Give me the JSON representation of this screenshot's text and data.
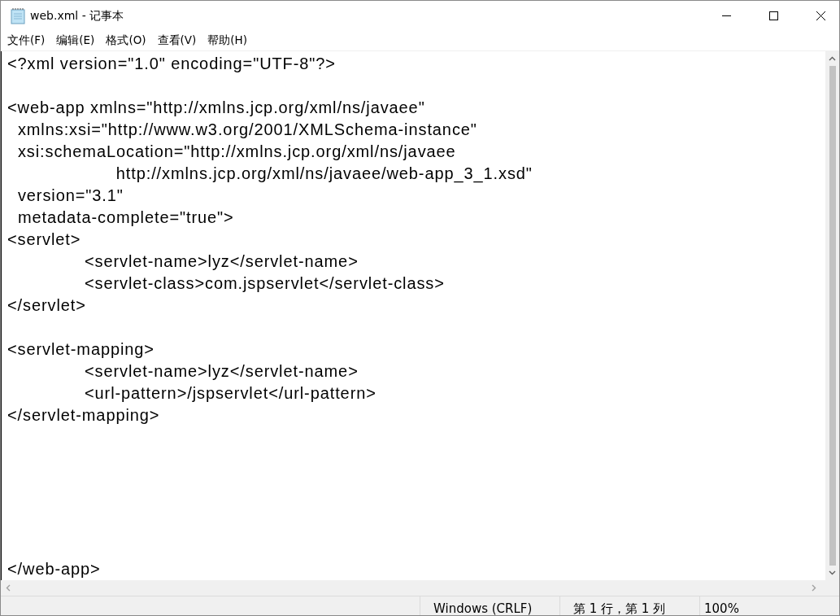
{
  "window": {
    "title": "web.xml - 记事本"
  },
  "menu": [
    "文件(F)",
    "编辑(E)",
    "格式(O)",
    "查看(V)",
    "帮助(H)"
  ],
  "editor": {
    "text": "<?xml version=\"1.0\" encoding=\"UTF-8\"?>\n\n<web-app xmlns=\"http://xmlns.jcp.org/xml/ns/javaee\"\n  xmlns:xsi=\"http://www.w3.org/2001/XMLSchema-instance\"\n  xsi:schemaLocation=\"http://xmlns.jcp.org/xml/ns/javaee\n\t      http://xmlns.jcp.org/xml/ns/javaee/web-app_3_1.xsd\"\n  version=\"3.1\"\n  metadata-complete=\"true\">\n<servlet>\n\t<servlet-name>lyz</servlet-name>\n\t<servlet-class>com.jspservlet</servlet-class>\n</servlet>\n\n<servlet-mapping>\n\t<servlet-name>lyz</servlet-name>\n\t<url-pattern>/jspservlet</url-pattern>\n</servlet-mapping>\n\n\n\n\n\n\n</web-app>"
  },
  "status_bar": [
    "Windows (CRLF)",
    "第 1 行，第 1 列",
    "100%"
  ]
}
